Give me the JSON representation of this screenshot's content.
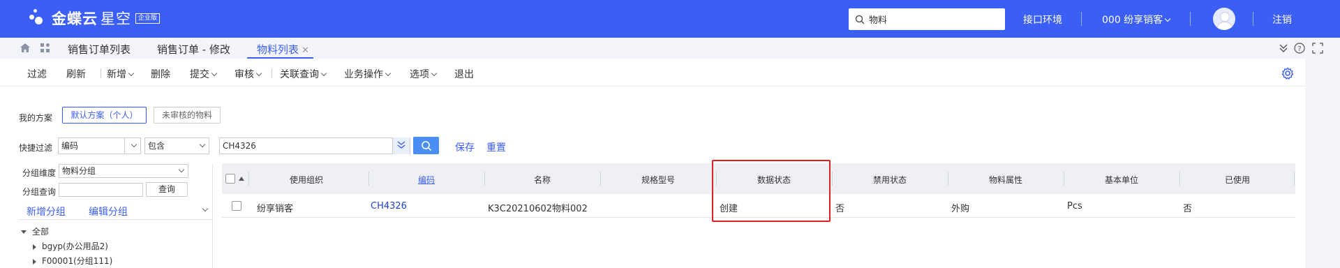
{
  "header": {
    "logo_text": "金蝶云",
    "logo_sub": "星空",
    "logo_badge": "企业版",
    "search_value": "物料",
    "env_label": "接口环境",
    "org_label": "000 纷享销客",
    "logout_label": "注销",
    "brand_color": "#3b5ef5"
  },
  "tabs": [
    {
      "label": "销售订单列表"
    },
    {
      "label": "销售订单 - 修改"
    },
    {
      "label": "物料列表",
      "active": true
    }
  ],
  "toolbar": {
    "filter": "过滤",
    "refresh": "刷新",
    "new": "新增",
    "delete": "删除",
    "submit": "提交",
    "audit": "审核",
    "linked_query": "关联查询",
    "business_ops": "业务操作",
    "options": "选项",
    "exit": "退出"
  },
  "filters": {
    "my_scheme_label": "我的方案",
    "scheme_default": "默认方案（个人）",
    "scheme_unaudited": "未审核的物料",
    "quick_filter_label": "快捷过滤",
    "field_select": "编码",
    "op_select": "包含",
    "value_input": "CH4326",
    "save": "保存",
    "reset": "重置"
  },
  "left_pane": {
    "group_dimension_label": "分组维度",
    "group_dimension_value": "物料分组",
    "group_query_label": "分组查询",
    "query_button": "查询",
    "add_group": "新增分组",
    "edit_group": "编辑分组",
    "tree": [
      {
        "label": "全部",
        "expanded": true
      },
      {
        "label": "bgyp(办公用品2)"
      },
      {
        "label": "F00001(分组111)"
      }
    ]
  },
  "grid": {
    "columns": [
      "使用组织",
      "编码",
      "名称",
      "规格型号",
      "数据状态",
      "禁用状态",
      "物料属性",
      "基本单位",
      "已使用"
    ],
    "rows": [
      [
        "纷享销客",
        "CH4326",
        "K3C20210602物料002",
        "",
        "创建",
        "否",
        "外购",
        "Pcs",
        "否"
      ]
    ]
  }
}
